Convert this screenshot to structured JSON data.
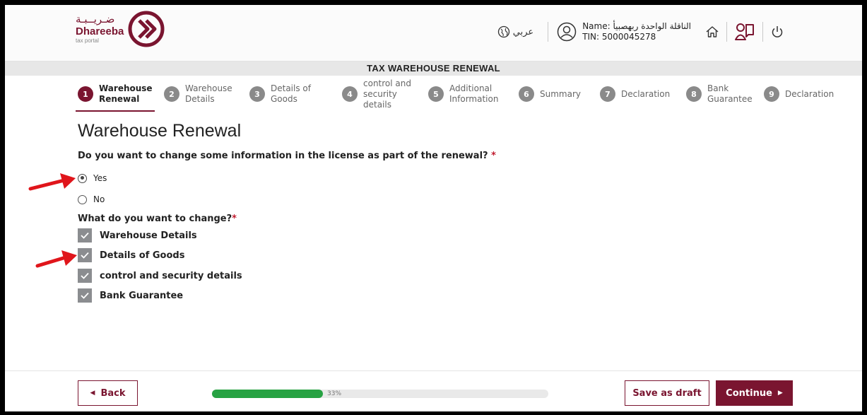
{
  "header": {
    "logo_arabic": "ضـريــبـة",
    "logo_name": "Dhareeba",
    "logo_sub": "tax portal",
    "language_label": "عربي",
    "user_name": "Name: الناقلة الواحدة ربهصبيأ",
    "user_tin": "TIN: 5000045278",
    "icons": [
      "globe-icon",
      "user-circle-icon",
      "home-icon",
      "book-user-icon",
      "power-icon"
    ]
  },
  "title_bar": "TAX WAREHOUSE RENEWAL",
  "steps": [
    {
      "num": "1",
      "label_1": "Warehouse",
      "label_2": "Renewal",
      "active": true
    },
    {
      "num": "2",
      "label_1": "Warehouse",
      "label_2": "Details"
    },
    {
      "num": "3",
      "label_1": "Details of",
      "label_2": "Goods"
    },
    {
      "num": "4",
      "label_1": "control and",
      "label_2": "security",
      "label_3": "details"
    },
    {
      "num": "5",
      "label_1": "Additional",
      "label_2": "Information"
    },
    {
      "num": "6",
      "label_1": "Summary"
    },
    {
      "num": "7",
      "label_1": "Declaration"
    },
    {
      "num": "8",
      "label_1": "Bank",
      "label_2": "Guarantee"
    },
    {
      "num": "9",
      "label_1": "Declaration"
    }
  ],
  "main": {
    "title": "Warehouse Renewal",
    "question": "Do you want to change some information in the license as part of the renewal?",
    "required_mark": "*",
    "options": [
      {
        "label": "Yes",
        "selected": true
      },
      {
        "label": "No",
        "selected": false
      }
    ],
    "change_question": "What do you want to change?",
    "changes": [
      {
        "label": "Warehouse Details",
        "checked": true
      },
      {
        "label": "Details of Goods",
        "checked": true
      },
      {
        "label": "control and security details",
        "checked": true
      },
      {
        "label": "Bank Guarantee",
        "checked": true
      }
    ]
  },
  "footer": {
    "back_label": "Back",
    "progress_value": 0.33,
    "progress_text": "33%",
    "draft_label": "Save as draft",
    "continue_label": "Continue"
  },
  "colors": {
    "brand": "#7a1530",
    "progress": "#27a243",
    "annotation_arrow": "#e0151b",
    "checkbox": "#8b8d90"
  }
}
